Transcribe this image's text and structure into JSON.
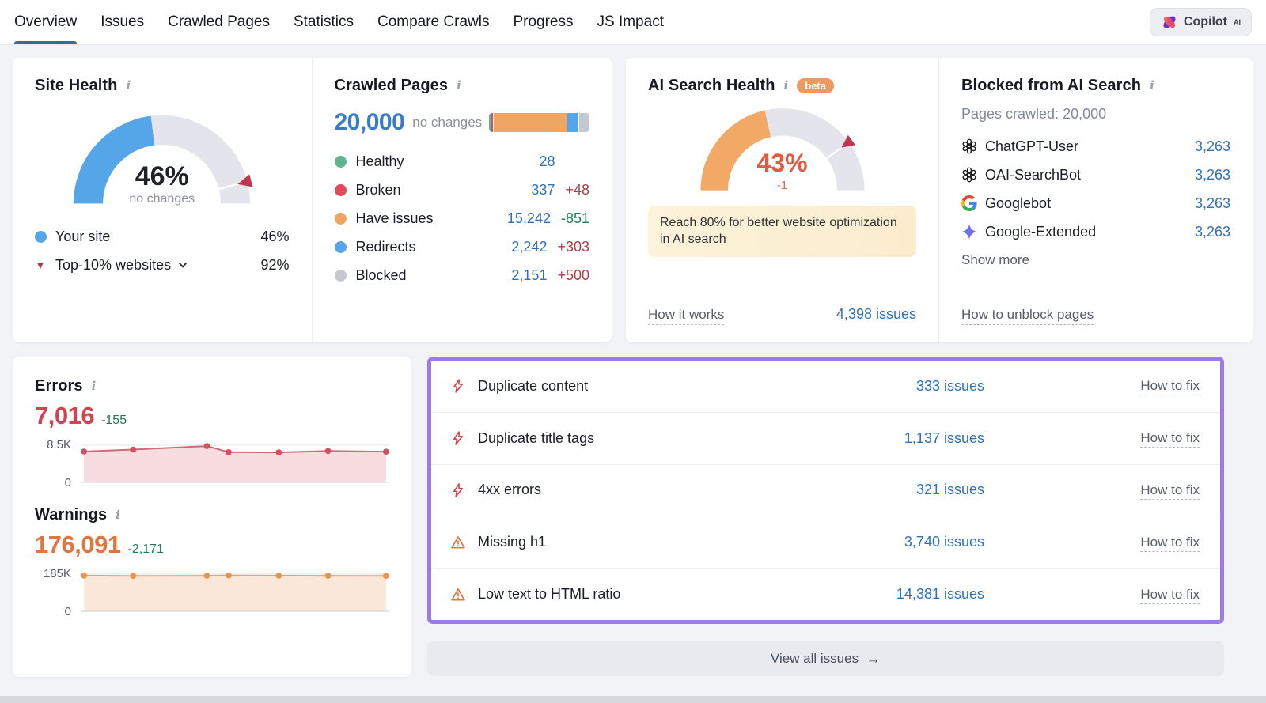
{
  "colors": {
    "accent_blue": "#55a6e8",
    "gauge_track": "#e4e5ec",
    "marker_red": "#c23550",
    "link_blue": "#2f71b8",
    "error_red": "#d4424e",
    "warning_orange": "#e0763d",
    "ai_percent_orange": "#e25a3f",
    "gauge_fill_orange": "#f2a965",
    "highlight_purple": "#9c7ce4",
    "delta_bad_red": "#b03a46",
    "delta_good_green": "#1e7a56"
  },
  "nav": {
    "tabs": [
      {
        "label": "Overview",
        "active": true
      },
      {
        "label": "Issues",
        "active": false
      },
      {
        "label": "Crawled Pages",
        "active": false
      },
      {
        "label": "Statistics",
        "active": false
      },
      {
        "label": "Compare Crawls",
        "active": false
      },
      {
        "label": "Progress",
        "active": false
      },
      {
        "label": "JS Impact",
        "active": false
      }
    ],
    "copilot": {
      "label": "Copilot",
      "superscript": "AI"
    }
  },
  "site_health": {
    "title": "Site Health",
    "gauge": {
      "percent": 46,
      "marker_percent": 92,
      "fill": "#55a6e8",
      "track": "#e4e5ec",
      "marker": "#c23550"
    },
    "value_label": "46%",
    "sub_label": "no changes",
    "legend": [
      {
        "label": "Your site",
        "value": "46%"
      },
      {
        "label": "Top-10% websites",
        "value": "92%"
      }
    ]
  },
  "crawled_pages": {
    "title": "Crawled Pages",
    "total": "20,000",
    "change_label": "no changes",
    "legend": [
      {
        "label": "Healthy",
        "color": "#5fb591",
        "count": "28",
        "value": 28,
        "delta": "",
        "delta_type": ""
      },
      {
        "label": "Broken",
        "color": "#e2495a",
        "count": "337",
        "value": 337,
        "delta": "+48",
        "delta_type": "bad"
      },
      {
        "label": "Have issues",
        "color": "#f0a663",
        "count": "15,242",
        "value": 15242,
        "delta": "-851",
        "delta_type": "good"
      },
      {
        "label": "Redirects",
        "color": "#55a6e8",
        "count": "2,242",
        "value": 2242,
        "delta": "+303",
        "delta_type": "bad"
      },
      {
        "label": "Blocked",
        "color": "#c6c8cf",
        "count": "2,151",
        "value": 2151,
        "delta": "+500",
        "delta_type": "bad"
      }
    ]
  },
  "ai_search_health": {
    "title": "AI Search Health",
    "beta_label": "beta",
    "gauge": {
      "percent": 43,
      "marker_percent": 80,
      "fill": "#f2a965",
      "track": "#e4e5ec",
      "marker": "#c23550"
    },
    "value_label": "43%",
    "sub_label": "-1",
    "notice": "Reach 80% for better website optimization in AI search",
    "how_it_works_label": "How it works",
    "issues_link": "4,398 issues"
  },
  "blocked_ai": {
    "title": "Blocked from AI Search",
    "subtitle": "Pages crawled: 20,000",
    "bots": [
      {
        "icon": "openai",
        "name": "ChatGPT-User",
        "count": "3,263"
      },
      {
        "icon": "openai",
        "name": "OAI-SearchBot",
        "count": "3,263"
      },
      {
        "icon": "google",
        "name": "Googlebot",
        "count": "3,263"
      },
      {
        "icon": "gemini",
        "name": "Google-Extended",
        "count": "3,263"
      }
    ],
    "show_more_label": "Show more",
    "unblock_label": "How to unblock pages"
  },
  "errors": {
    "title": "Errors",
    "count": "7,016",
    "delta": "-155",
    "delta_type": "good",
    "chart": {
      "ymax_label": "8.5K",
      "ymin_label": "0",
      "ymax": 8500,
      "x_fracs": [
        0,
        0.163,
        0.407,
        0.479,
        0.645,
        0.808,
        1
      ],
      "values": [
        7050,
        7500,
        8300,
        6900,
        6850,
        7171,
        7016
      ],
      "line": "#d06a74",
      "fill": "#f8dde0",
      "dot": "#cf5260"
    }
  },
  "warnings": {
    "title": "Warnings",
    "count": "176,091",
    "delta": "-2,171",
    "delta_type": "good",
    "chart": {
      "ymax_label": "185K",
      "ymin_label": "0",
      "ymax": 185000,
      "x_fracs": [
        0,
        0.163,
        0.407,
        0.479,
        0.645,
        0.808,
        1
      ],
      "values": [
        177500,
        176400,
        176900,
        178262,
        177300,
        176900,
        176091
      ],
      "line": "#e8a172",
      "fill": "#fbe7d8",
      "dot": "#e8944e"
    }
  },
  "issues_panel": {
    "items": [
      {
        "severity": "error",
        "label": "Duplicate content",
        "count_label": "333 issues",
        "fix_label": "How to fix"
      },
      {
        "severity": "error",
        "label": "Duplicate title tags",
        "count_label": "1,137 issues",
        "fix_label": "How to fix"
      },
      {
        "severity": "error",
        "label": "4xx errors",
        "count_label": "321 issues",
        "fix_label": "How to fix"
      },
      {
        "severity": "warning",
        "label": "Missing h1",
        "count_label": "3,740 issues",
        "fix_label": "How to fix"
      },
      {
        "severity": "warning",
        "label": "Low text to HTML ratio",
        "count_label": "14,381 issues",
        "fix_label": "How to fix"
      }
    ],
    "view_all_label": "View all issues"
  },
  "chart_data": [
    {
      "type": "gauge",
      "title": "Site Health",
      "value_percent": 46,
      "benchmark_percent": 92,
      "center_label": "46%",
      "sub_label": "no changes"
    },
    {
      "type": "gauge",
      "title": "AI Search Health",
      "value_percent": 43,
      "target_percent": 80,
      "center_label": "43%",
      "sub_label": "-1"
    },
    {
      "type": "area",
      "title": "Errors",
      "ylim": [
        0,
        8500
      ],
      "ytick_labels": [
        "0",
        "8.5K"
      ],
      "values": [
        7050,
        7500,
        8300,
        6900,
        6850,
        7171,
        7016
      ]
    },
    {
      "type": "area",
      "title": "Warnings",
      "ylim": [
        0,
        185000
      ],
      "ytick_labels": [
        "0",
        "185K"
      ],
      "values": [
        177500,
        176400,
        176900,
        178262,
        177300,
        176900,
        176091
      ]
    },
    {
      "type": "bar",
      "title": "Crawled Pages",
      "categories": [
        "Healthy",
        "Broken",
        "Have issues",
        "Redirects",
        "Blocked"
      ],
      "values": [
        28,
        337,
        15242,
        2242,
        2151
      ],
      "total": 20000
    }
  ]
}
